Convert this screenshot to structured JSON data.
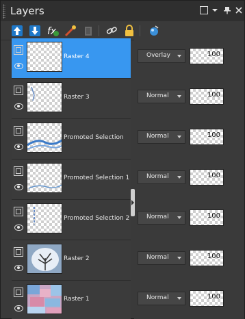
{
  "panel": {
    "title": "Layers"
  },
  "titlebar_icons": [
    "maximize-icon",
    "dropdown-icon",
    "pin-icon",
    "close-icon"
  ],
  "toolbar": {
    "tools": [
      "new-raster-layer-icon",
      "new-vector-layer-icon",
      "new-mask-layer-icon",
      "layer-effects-icon",
      "delete-layer-icon",
      "link-layer-icon",
      "lock-layer-icon",
      "layer-properties-icon"
    ]
  },
  "layers": [
    {
      "name": "Raster 4",
      "blend_mode": "Overlay",
      "opacity": "100",
      "selected": true
    },
    {
      "name": "Raster 3",
      "blend_mode": "Normal",
      "opacity": "100",
      "selected": false
    },
    {
      "name": "Promoted Selection",
      "blend_mode": "Normal",
      "opacity": "100",
      "selected": false
    },
    {
      "name": "Promoted Selection 1",
      "blend_mode": "Normal",
      "opacity": "100",
      "selected": false
    },
    {
      "name": "Promoted Selection 2",
      "blend_mode": "Normal",
      "opacity": "100",
      "selected": false
    },
    {
      "name": "Raster 2",
      "blend_mode": "Normal",
      "opacity": "100",
      "selected": false
    },
    {
      "name": "Raster 1",
      "blend_mode": "Normal",
      "opacity": "100",
      "selected": false
    }
  ],
  "colors": {
    "selected": "#3897f0",
    "panel_bg": "#3a3a3a",
    "titlebar_bg": "#2f2f2f"
  }
}
